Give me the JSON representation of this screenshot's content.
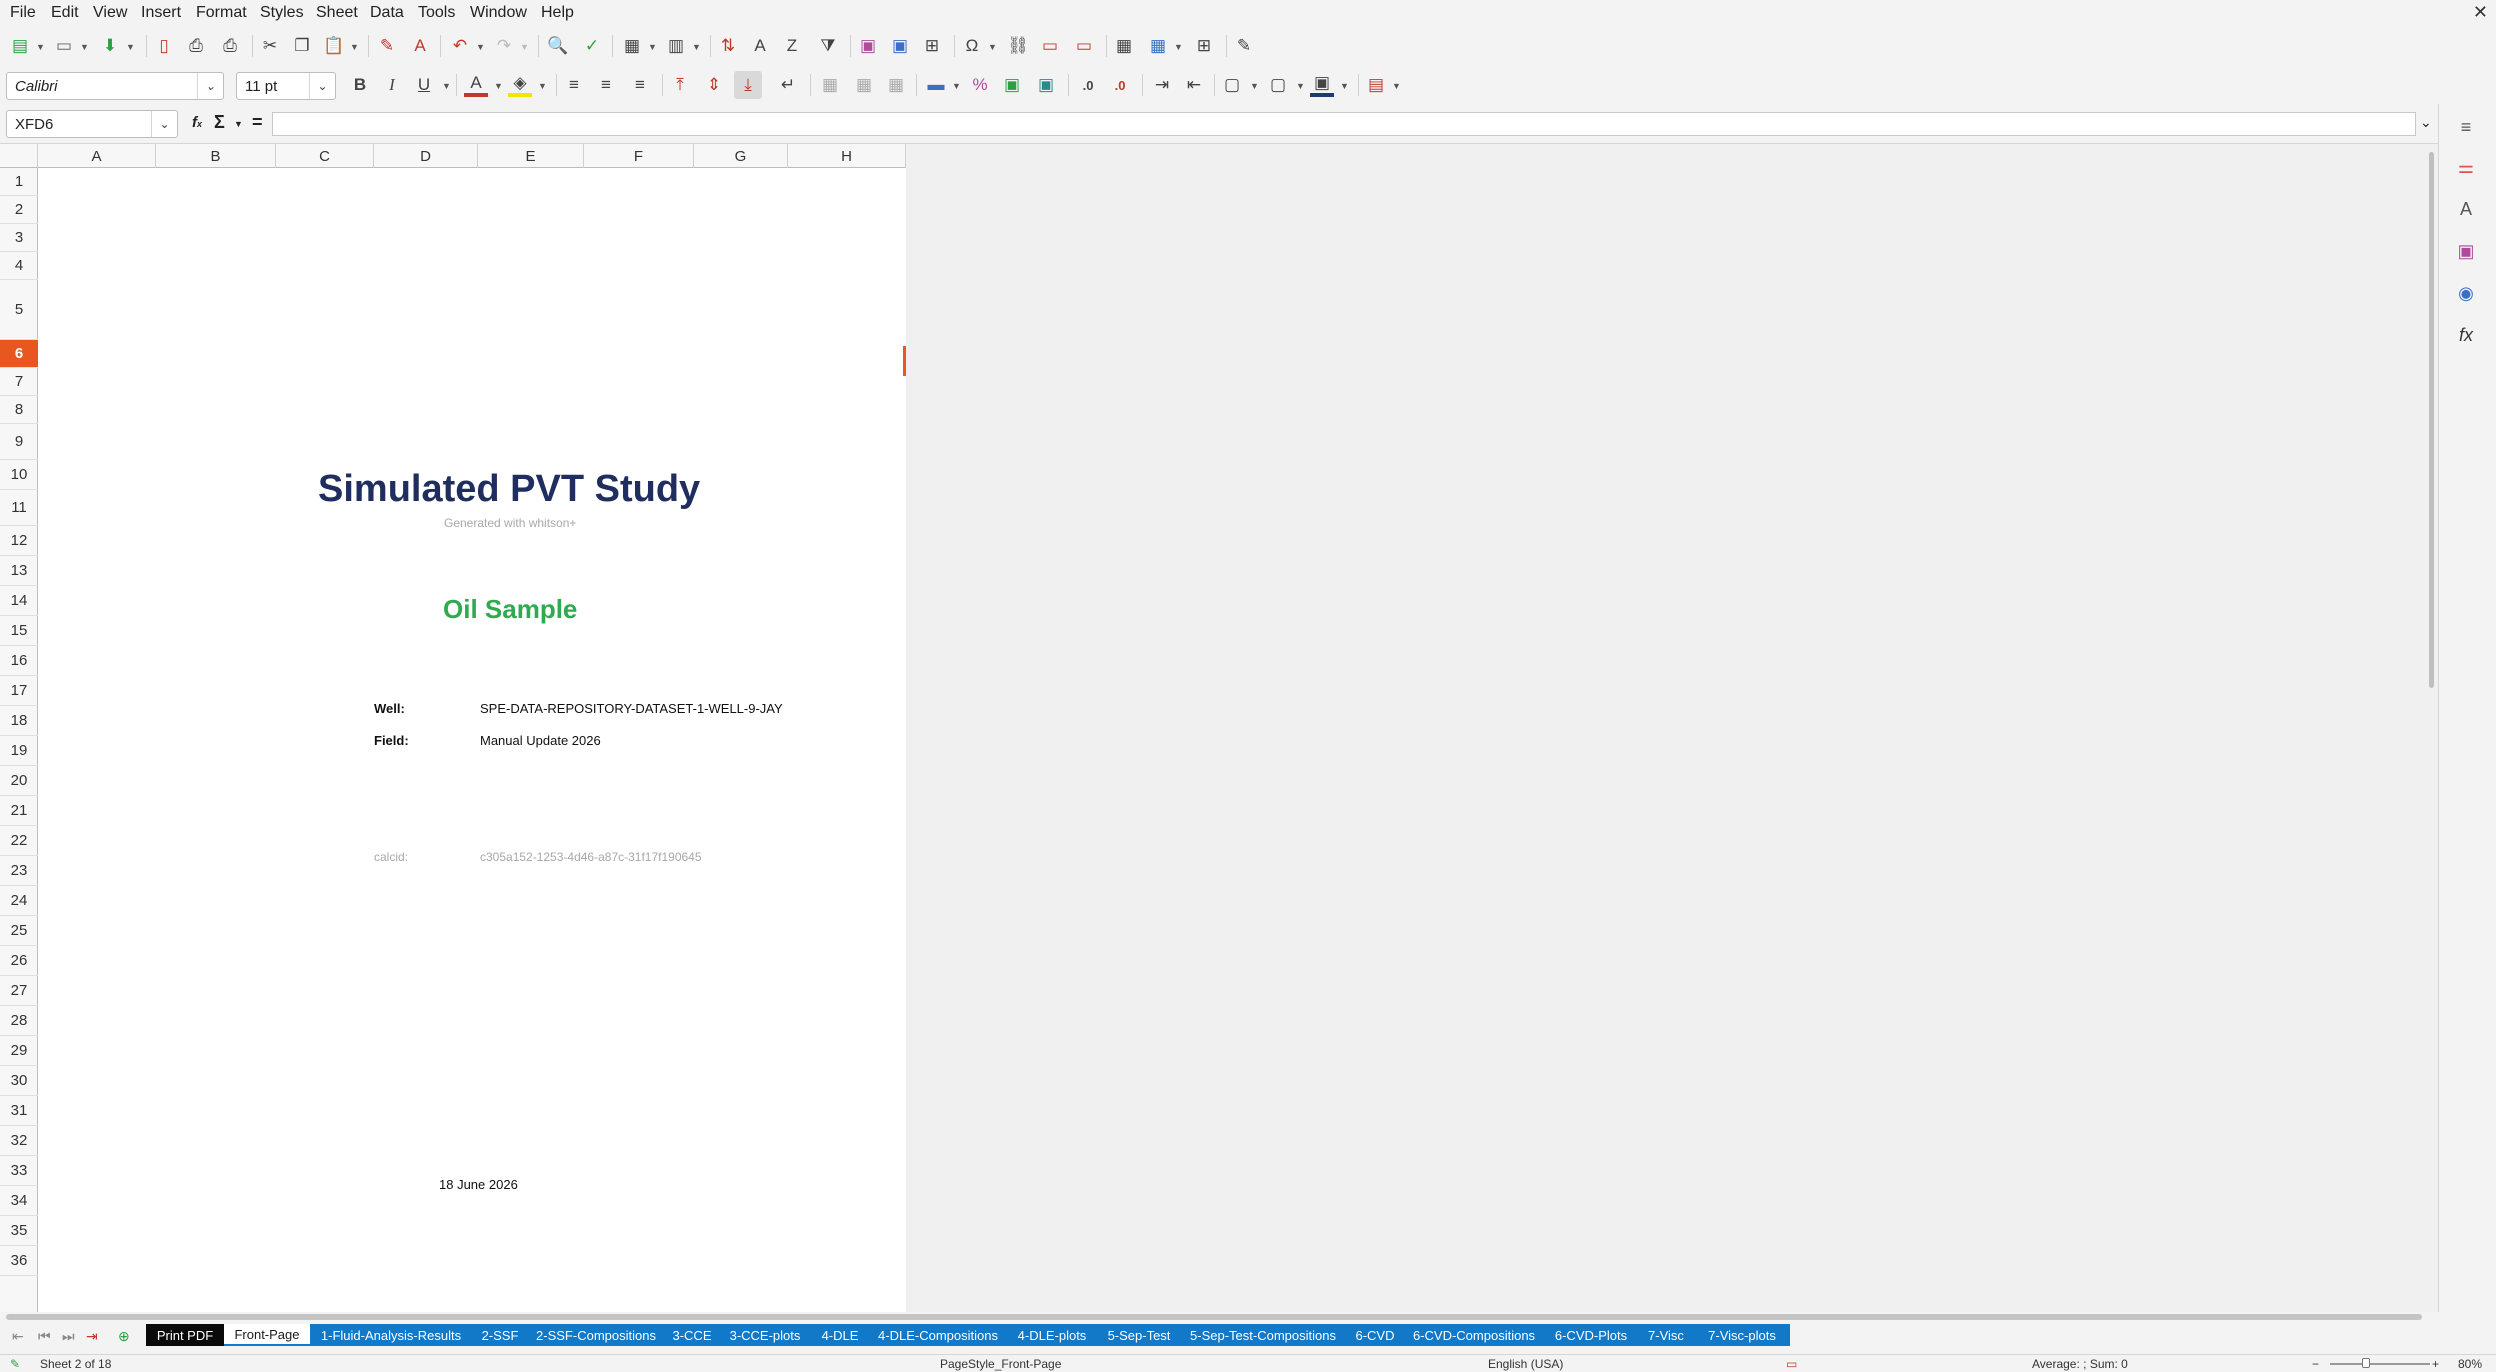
{
  "menu": [
    "File",
    "Edit",
    "View",
    "Insert",
    "Format",
    "Styles",
    "Sheet",
    "Data",
    "Tools",
    "Window",
    "Help"
  ],
  "formatting": {
    "font_name": "Calibri",
    "font_size": "11 pt"
  },
  "formula_bar": {
    "name_box": "XFD6",
    "function_wizard": "f",
    "sum_symbol": "Σ",
    "equals_symbol": "=",
    "content": ""
  },
  "columns": [
    "A",
    "B",
    "C",
    "D",
    "E",
    "F",
    "G",
    "H"
  ],
  "rows": [
    "1",
    "2",
    "3",
    "4",
    "5",
    "6",
    "7",
    "8",
    "9",
    "10",
    "11",
    "12",
    "13",
    "14",
    "15",
    "16",
    "17",
    "18",
    "19",
    "20",
    "21",
    "22",
    "23",
    "24",
    "25",
    "26",
    "27",
    "28",
    "29",
    "30",
    "31",
    "32",
    "33",
    "34",
    "35",
    "36"
  ],
  "active_row": "6",
  "document": {
    "title": "Simulated PVT Study",
    "subtitle": "Generated with whitson+",
    "sample_type": "Oil Sample",
    "well_label": "Well:",
    "well_value": "SPE-DATA-REPOSITORY-DATASET-1-WELL-9-JAY",
    "field_label": "Field:",
    "field_value": "Manual Update 2026",
    "calcid_label": "calcid:",
    "calcid_value": "c305a152-1253-4d46-a87c-31f17f190645",
    "date": "18 June 2026"
  },
  "sheet_tabs": [
    "Print PDF",
    "Front-Page",
    "1-Fluid-Analysis-Results",
    "2-SSF",
    "2-SSF-Compositions",
    "3-CCE",
    "3-CCE-plots",
    "4-DLE",
    "4-DLE-Compositions",
    "4-DLE-plots",
    "5-Sep-Test",
    "5-Sep-Test-Compositions",
    "6-CVD",
    "6-CVD-Compositions",
    "6-CVD-Plots",
    "7-Visc",
    "7-Visc-plots"
  ],
  "active_tab": "Front-Page",
  "tab_colors": {
    "default": "#1278c8",
    "print_pdf": "#0a0a0a"
  },
  "status_bar": {
    "sheet_info": "Sheet 2 of 18",
    "page_style": "PageStyle_Front-Page",
    "language": "English (USA)",
    "summary": "Average: ; Sum: 0",
    "zoom": "80%",
    "zoom_minus": "−",
    "zoom_plus": "+"
  },
  "accent_colors": {
    "title": "#1f2e5e",
    "sample": "#2eaa4f",
    "active_row": "#e8581e"
  }
}
